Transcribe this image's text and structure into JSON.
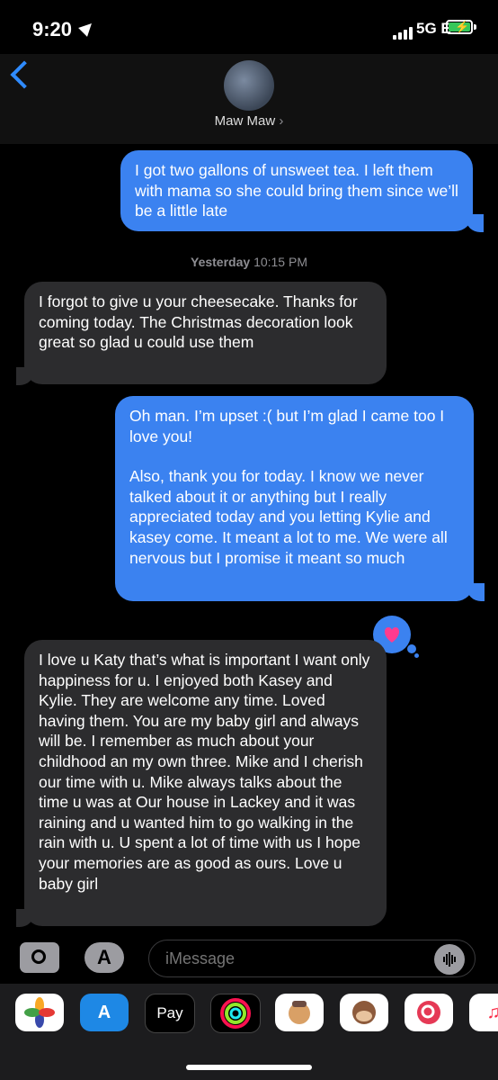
{
  "status_bar": {
    "time": "9:20",
    "network": "5G E"
  },
  "header": {
    "contact_name": "Maw Maw",
    "chevron": "›"
  },
  "messages": {
    "out1": "I got two gallons of unsweet tea. I left them with mama so she could bring them since we’ll be a little late",
    "timestamp_day": "Yesterday",
    "timestamp_time": "10:15 PM",
    "in1": "I forgot to give u your cheesecake. Thanks for coming today.  The Christmas decoration look great so glad u could use them",
    "out2_p1": "Oh man. I’m upset :( but I’m glad I came too I love you!",
    "out2_p2": "Also, thank you for today. I know we never talked about it or anything but I really appreciated today and you letting Kylie and kasey come. It meant a lot to me. We were all nervous but I promise it meant so much",
    "in2": "I love u Katy that’s what is important  I want only happiness for u. I enjoyed both Kasey and Kylie. They are welcome any time. Loved having them. You are my baby girl and always will be. I remember as much about your childhood an my own three. Mike and I cherish our time with u. Mike always talks about the time u was at Our house in Lackey and it was raining and u wanted him to go walking in the rain with u. U spent a lot of time with us I hope your memories are as good as ours. Love u baby girl",
    "tapback": "heart"
  },
  "input": {
    "placeholder": "iMessage"
  },
  "app_tray": {
    "icons": [
      "photos-icon",
      "app-store-icon",
      "apple-pay-icon",
      "activity-icon",
      "memoji-icon",
      "monkey-animoji-icon",
      "search-images-icon",
      "music-icon"
    ],
    "apple_pay_label": "Pay"
  },
  "colors": {
    "outgoing": "#3b82f0",
    "incoming": "#2c2c2e",
    "accent": "#2f8bff"
  }
}
